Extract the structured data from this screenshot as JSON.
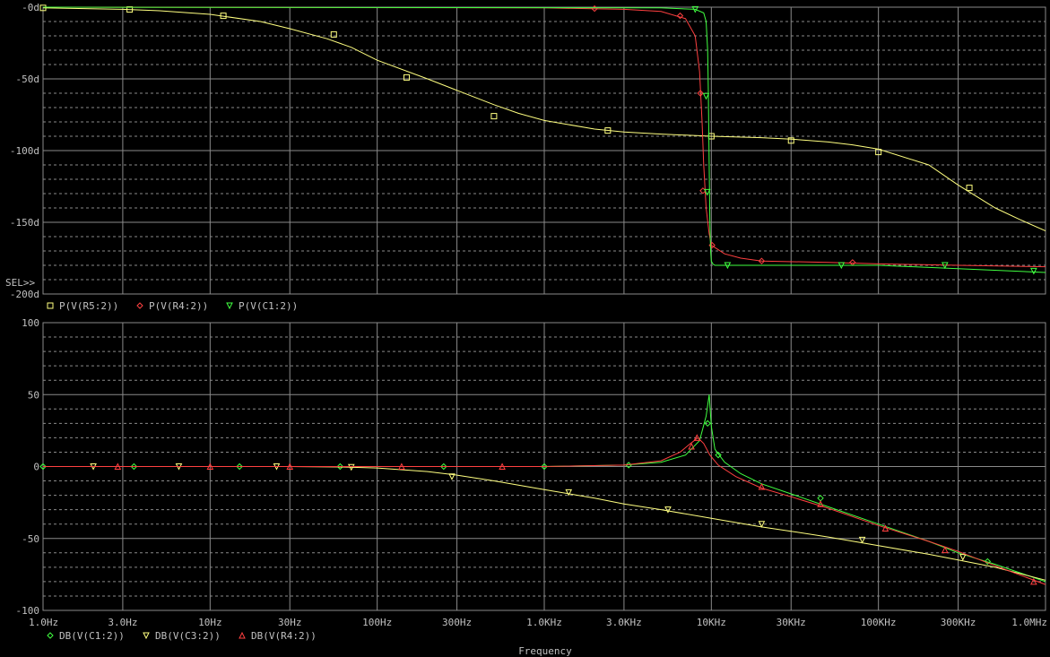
{
  "window": {
    "background": "#000000",
    "grid_color": "#8a8a8a",
    "text_color": "#c0c0c0"
  },
  "x_axis": {
    "label": "Frequency",
    "scale": "log",
    "range": [
      1,
      1000000
    ],
    "ticks": [
      {
        "value": 1,
        "label": "1.0Hz"
      },
      {
        "value": 3,
        "label": "3.0Hz"
      },
      {
        "value": 10,
        "label": "10Hz"
      },
      {
        "value": 30,
        "label": "30Hz"
      },
      {
        "value": 100,
        "label": "100Hz"
      },
      {
        "value": 300,
        "label": "300Hz"
      },
      {
        "value": 1000,
        "label": "1.0KHz"
      },
      {
        "value": 3000,
        "label": "3.0KHz"
      },
      {
        "value": 10000,
        "label": "10KHz"
      },
      {
        "value": 30000,
        "label": "30KHz"
      },
      {
        "value": 100000,
        "label": "100KHz"
      },
      {
        "value": 300000,
        "label": "300KHz"
      },
      {
        "value": 1000000,
        "label": "1.0MHz"
      }
    ]
  },
  "chart_data": [
    {
      "type": "line",
      "panel": "phase",
      "title": "",
      "x_scale": "log",
      "xlim": [
        1,
        1000000
      ],
      "ylim": [
        -200,
        0
      ],
      "y_ticks": [
        {
          "value": 0,
          "label": "-0d"
        },
        {
          "value": -50,
          "label": "-50d"
        },
        {
          "value": -100,
          "label": "-100d"
        },
        {
          "value": -150,
          "label": "-150d"
        },
        {
          "value": -200,
          "label": "-200d"
        }
      ],
      "selector_label": "SEL>>",
      "grid": true,
      "legend_placement": "below",
      "series": [
        {
          "name": "P(V(R5:2))",
          "color": "#ffff80",
          "marker": "square",
          "x": [
            1,
            3,
            5,
            10,
            20,
            30,
            50,
            70,
            100,
            200,
            300,
            500,
            700,
            1000,
            2000,
            3000,
            5000,
            10000,
            20000,
            30000,
            50000,
            70000,
            100000,
            200000,
            300000,
            500000,
            700000,
            1000000
          ],
          "y": [
            -0.5,
            -1.5,
            -2.5,
            -5,
            -10,
            -15,
            -22,
            -28,
            -37,
            -50,
            -58,
            -68,
            -74,
            -79,
            -85,
            -87,
            -88.5,
            -90,
            -91,
            -92,
            -94,
            -96,
            -99,
            -110,
            -124,
            -140,
            -148,
            -156
          ],
          "marker_x": [
            1,
            3.3,
            12,
            55,
            150,
            500,
            2400,
            10000,
            30000,
            100000,
            350000
          ],
          "marker_y": [
            -0.5,
            -1.6,
            -6,
            -19,
            -49,
            -76,
            -86,
            -90,
            -93,
            -101,
            -126
          ]
        },
        {
          "name": "P(V(R4:2))",
          "color": "#ff4040",
          "marker": "diamond",
          "x": [
            1,
            1000,
            3000,
            5000,
            7000,
            8000,
            8500,
            8800,
            9000,
            9300,
            9700,
            10000,
            12000,
            15000,
            20000,
            50000,
            100000,
            300000,
            1000000
          ],
          "y": [
            0,
            -0.5,
            -1.5,
            -3,
            -8,
            -20,
            -45,
            -80,
            -110,
            -140,
            -158,
            -166,
            -172,
            -175,
            -177,
            -178,
            -179,
            -180,
            -181
          ],
          "marker_x": [
            2000,
            6500,
            8600,
            8900,
            10100,
            20000,
            70000
          ],
          "marker_y": [
            -1,
            -6,
            -60,
            -128,
            -166,
            -177,
            -178
          ]
        },
        {
          "name": "P(V(C1:2))",
          "color": "#40ff40",
          "marker": "triangle-down",
          "x": [
            1,
            5000,
            8000,
            9000,
            9300,
            9500,
            9600,
            9700,
            9800,
            9900,
            10000,
            10200,
            10500,
            12000,
            20000,
            100000,
            1000000
          ],
          "y": [
            0,
            -0.5,
            -1.5,
            -4,
            -10,
            -30,
            -60,
            -110,
            -150,
            -170,
            -177,
            -179,
            -180,
            -180,
            -180,
            -180,
            -185
          ],
          "marker_x": [
            8000,
            9300,
            9450,
            12500,
            60000,
            250000,
            850000
          ],
          "marker_y": [
            -1.5,
            -62,
            -129,
            -180,
            -180,
            -180,
            -184
          ]
        }
      ]
    },
    {
      "type": "line",
      "panel": "magnitude",
      "title": "",
      "xlabel": "Frequency",
      "x_scale": "log",
      "xlim": [
        1,
        1000000
      ],
      "ylim": [
        -100,
        100
      ],
      "y_ticks": [
        {
          "value": 100,
          "label": "100"
        },
        {
          "value": 50,
          "label": "50"
        },
        {
          "value": 0,
          "label": "0"
        },
        {
          "value": -50,
          "label": "-50"
        },
        {
          "value": -100,
          "label": "-100"
        }
      ],
      "grid": true,
      "legend_placement": "below",
      "series": [
        {
          "name": "DB(V(C1:2))",
          "color": "#40ff40",
          "marker": "diamond",
          "x": [
            1,
            1000,
            3000,
            5000,
            7000,
            8500,
            9300,
            9700,
            10000,
            10500,
            12000,
            15000,
            20000,
            30000,
            50000,
            100000,
            200000,
            300000,
            500000,
            1000000
          ],
          "y": [
            0,
            0,
            1,
            3,
            8,
            18,
            35,
            50,
            28,
            12,
            3,
            -5,
            -12,
            -19,
            -28,
            -40,
            -52,
            -60,
            -68,
            -80
          ],
          "marker_x": [
            1,
            3.5,
            15,
            60,
            250,
            1000,
            3200,
            9500,
            11000,
            45000,
            450000
          ],
          "marker_y": [
            0,
            0,
            0,
            0,
            0,
            0,
            1,
            30,
            8,
            -22,
            -66
          ]
        },
        {
          "name": "DB(V(C3:2))",
          "color": "#ffff80",
          "marker": "triangle-down",
          "x": [
            1,
            10,
            30,
            60,
            100,
            200,
            300,
            500,
            1000,
            2000,
            3000,
            5000,
            10000,
            20000,
            30000,
            50000,
            100000,
            200000,
            300000,
            500000,
            1000000
          ],
          "y": [
            0,
            0,
            0,
            -0.3,
            -1,
            -3.5,
            -6,
            -10,
            -16,
            -22,
            -26,
            -30,
            -36,
            -42,
            -45,
            -49,
            -55,
            -61,
            -65,
            -70,
            -79
          ],
          "marker_x": [
            2,
            6.5,
            25,
            70,
            280,
            1400,
            5500,
            20000,
            80000,
            320000
          ],
          "marker_y": [
            0,
            0,
            0,
            -0.5,
            -7,
            -18,
            -30,
            -40,
            -51,
            -63
          ]
        },
        {
          "name": "DB(V(R4:2))",
          "color": "#ff4040",
          "marker": "triangle-up",
          "x": [
            1,
            1000,
            3000,
            5000,
            6500,
            7500,
            8300,
            9000,
            9800,
            11000,
            14000,
            20000,
            30000,
            50000,
            100000,
            200000,
            300000,
            500000,
            1000000
          ],
          "y": [
            0,
            0,
            1,
            4,
            10,
            16,
            20,
            16,
            8,
            1,
            -7,
            -15,
            -21,
            -29,
            -41,
            -52,
            -59,
            -69,
            -82
          ],
          "marker_x": [
            2.8,
            10,
            30,
            140,
            560,
            7600,
            8200,
            20000,
            45000,
            110000,
            250000,
            850000
          ],
          "marker_y": [
            0,
            0,
            0,
            0,
            0,
            14,
            20,
            -14,
            -26,
            -43,
            -58,
            -80
          ]
        }
      ]
    }
  ]
}
